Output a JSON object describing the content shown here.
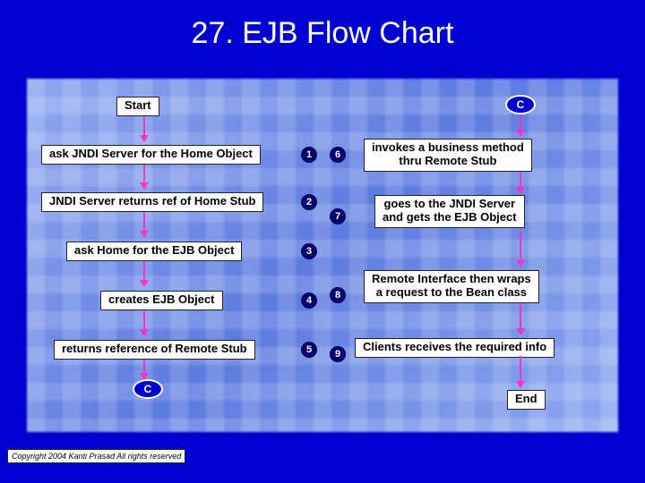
{
  "title": "27. EJB Flow Chart",
  "start_label": "Start",
  "end_label": "End",
  "connector_label": "C",
  "left_steps": [
    "ask JNDI Server for the Home Object",
    "JNDI Server returns ref of Home Stub",
    "ask Home for the EJB Object",
    "creates EJB Object",
    "returns reference of Remote Stub"
  ],
  "left_numbers": [
    "1",
    "2",
    "3",
    "4",
    "5"
  ],
  "right_steps": [
    "invokes a business method\nthru Remote Stub",
    "goes to the JNDI Server\nand gets the EJB Object",
    "Remote Interface then wraps\na request to the Bean class",
    "Clients receives the required info"
  ],
  "right_numbers": [
    "6",
    "7",
    "8",
    "9"
  ],
  "copyright": "Copyright 2004 Kanti Prasad All rights reserved"
}
